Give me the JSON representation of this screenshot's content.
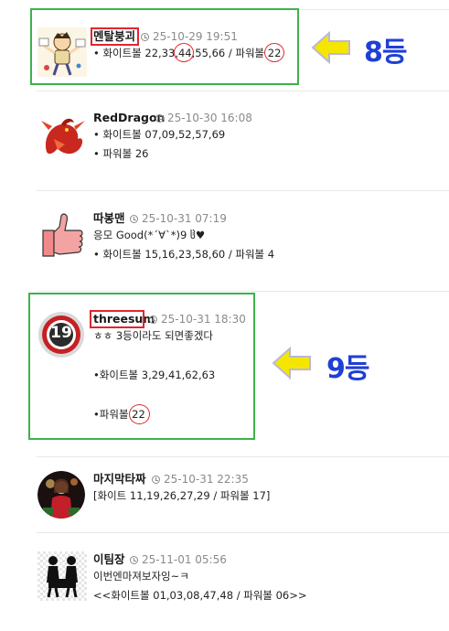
{
  "posts": [
    {
      "name": "멘탈붕괴",
      "time": "25-10-29 19:51",
      "lines": [
        "• 화이트볼 22,33,44,55,66 / 파워볼 22"
      ]
    },
    {
      "name": "RedDragon",
      "time": "25-10-30 16:08",
      "lines": [
        "• 화이트볼 07,09,52,57,69",
        "• 파워볼 26"
      ]
    },
    {
      "name": "따봉맨",
      "time": "25-10-31 07:19",
      "lines": [
        "응모 Good(*´∀`*)9 ჱ♥",
        "• 화이트볼 15,16,23,58,60 / 파워볼 4"
      ]
    },
    {
      "name": "threesum",
      "time": "25-10-31 18:30",
      "lines": [
        "ㅎㅎ 3등이라도 되면좋겠다",
        "•화이트볼 3,29,41,62,63",
        "•파워볼 22"
      ]
    },
    {
      "name": "마지막타짜",
      "time": "25-10-31 22:35",
      "lines": [
        "[화이트 11,19,26,27,29 / 파워볼 17]"
      ]
    },
    {
      "name": "이팀장",
      "time": "25-11-01 05:56",
      "lines": [
        "이번엔마져보자잉~ㅋ",
        "<<화이트볼 01,03,08,47,48 / 파워볼 06>>"
      ]
    }
  ],
  "annotations": {
    "rank1": "8등",
    "rank2": "9등",
    "avatar2_text": "19",
    "highlight_color": "#e0262f",
    "box_color": "#3db34a",
    "rank_color": "#1f3fd6",
    "arrow_color": "#f5e600"
  }
}
